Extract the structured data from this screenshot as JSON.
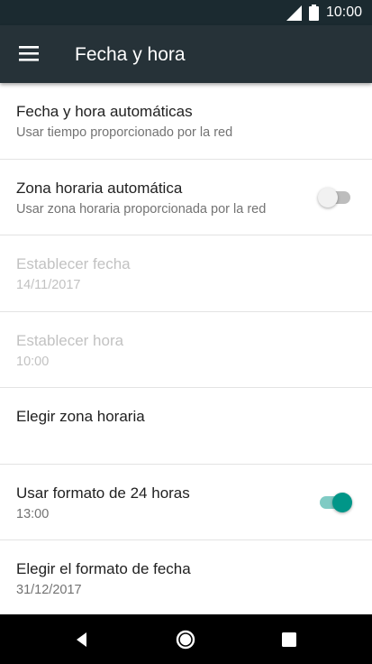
{
  "status_bar": {
    "time": "10:00",
    "icons": [
      "signal-icon",
      "battery-icon"
    ]
  },
  "app_bar": {
    "menu_icon": "menu-icon",
    "title": "Fecha y hora",
    "background_color": "#263238"
  },
  "settings": [
    {
      "title": "Fecha y hora automáticas",
      "subtitle": "Usar tiempo proporcionado por la red",
      "enabled": true
    },
    {
      "title": "Zona horaria automática",
      "subtitle": "Usar zona horaria proporcionada por la red",
      "enabled": true,
      "switch": "off"
    },
    {
      "title": "Establecer fecha",
      "subtitle": "14/11/2017",
      "enabled": false
    },
    {
      "title": "Establecer hora",
      "subtitle": "10:00",
      "enabled": false
    },
    {
      "title": "Elegir zona horaria",
      "subtitle": "",
      "enabled": true
    },
    {
      "title": "Usar formato de 24 horas",
      "subtitle": "13:00",
      "enabled": true,
      "switch": "on"
    },
    {
      "title": "Elegir el formato de fecha",
      "subtitle": "31/12/2017",
      "enabled": true
    }
  ],
  "nav_bar": {
    "icons": [
      "back-icon",
      "home-icon",
      "recents-icon"
    ]
  },
  "colors": {
    "accent": "#009688",
    "accent_track": "#80cbc4",
    "disabled_text": "#c2c2c2"
  }
}
